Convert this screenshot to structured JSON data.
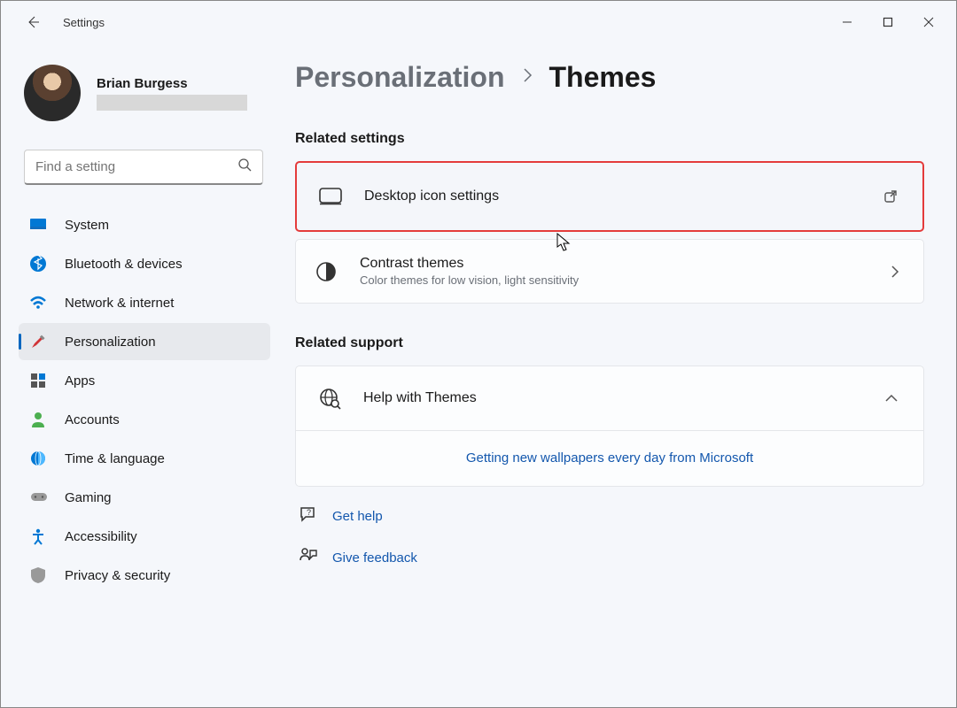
{
  "window": {
    "title": "Settings"
  },
  "profile": {
    "name": "Brian Burgess"
  },
  "search": {
    "placeholder": "Find a setting"
  },
  "nav": {
    "system": "System",
    "bluetooth": "Bluetooth & devices",
    "network": "Network & internet",
    "personalization": "Personalization",
    "apps": "Apps",
    "accounts": "Accounts",
    "time": "Time & language",
    "gaming": "Gaming",
    "accessibility": "Accessibility",
    "privacy": "Privacy & security"
  },
  "breadcrumb": {
    "parent": "Personalization",
    "current": "Themes"
  },
  "sections": {
    "related_settings": "Related settings",
    "related_support": "Related support"
  },
  "cards": {
    "desktop_icons": {
      "title": "Desktop icon settings"
    },
    "contrast": {
      "title": "Contrast themes",
      "sub": "Color themes for low vision, light sensitivity"
    }
  },
  "support": {
    "help_title": "Help with Themes",
    "wallpaper_link": "Getting new wallpapers every day from Microsoft"
  },
  "links": {
    "get_help": "Get help",
    "feedback": "Give feedback"
  }
}
